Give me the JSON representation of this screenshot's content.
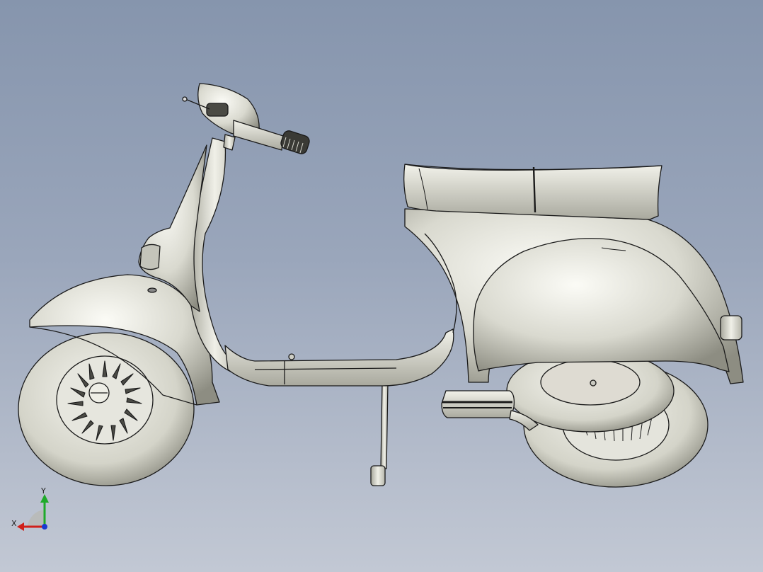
{
  "viewport": {
    "background_top": "#8695ad",
    "background_bottom": "#c2c8d4"
  },
  "model": {
    "subject": "scooter-3d-model",
    "render_style": "shaded-with-edges",
    "body_color": "#e6e6de",
    "edge_color": "#1a1a1a"
  },
  "triad": {
    "x_label": "X",
    "y_label": "Y",
    "x_color": "#d0201a",
    "y_color": "#1faa2a",
    "z_color": "#1a3bd0"
  }
}
